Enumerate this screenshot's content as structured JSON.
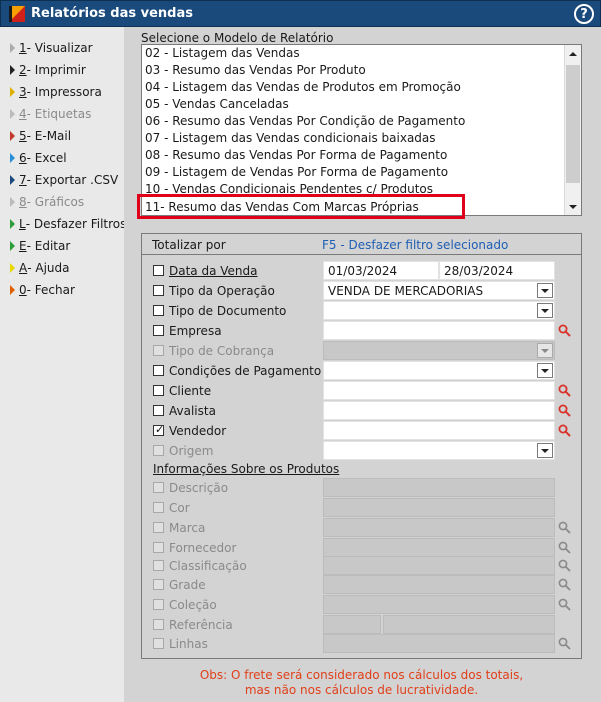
{
  "window": {
    "title": "Relatórios das vendas",
    "help_label": "?"
  },
  "sidebar": {
    "items": [
      {
        "key": "1",
        "text": " - Visualizar"
      },
      {
        "key": "2",
        "text": " - Imprimir"
      },
      {
        "key": "3",
        "text": " - Impressora"
      },
      {
        "key": "4",
        "text": " - Etiquetas"
      },
      {
        "key": "5",
        "text": " - E-Mail"
      },
      {
        "key": "6",
        "text": " - Excel"
      },
      {
        "key": "7",
        "text": " - Exportar .CSV"
      },
      {
        "key": "8",
        "text": " - Gráficos"
      },
      {
        "key": "L",
        "text": " - Desfazer Filtros"
      },
      {
        "key": "E",
        "text": " - Editar"
      },
      {
        "key": "A",
        "text": " - Ajuda"
      },
      {
        "key": "0",
        "text": " - Fechar"
      }
    ]
  },
  "report_select": {
    "label": "Selecione o Modelo de Relatório",
    "items": [
      "02 - Listagem das Vendas",
      "03 - Resumo das Vendas Por Produto",
      "04 - Listagem das Vendas de Produtos em Promoção",
      "05 - Vendas Canceladas",
      "06 - Resumo das Vendas Por Condição de Pagamento",
      "07 - Listagem das Vendas condicionais baixadas",
      "08 - Resumo das Vendas Por Forma de Pagamento",
      "09 - Listagem de Vendas Por Forma de Pagamento",
      "10 - Vendas Condicionais Pendentes c/ Produtos",
      "11- Resumo das Vendas Com Marcas Próprias"
    ]
  },
  "filters": {
    "totalizar": "Totalizar por",
    "f5": "F5 - Desfazer filtro selecionado",
    "data_venda": {
      "label": "Data da Venda",
      "from": "01/03/2024",
      "to": "28/03/2024"
    },
    "tipo_operacao": {
      "label": "Tipo da Operação",
      "value": "VENDA DE MERCADORIAS"
    },
    "tipo_documento": {
      "label": "Tipo de Documento"
    },
    "empresa": {
      "label": "Empresa"
    },
    "tipo_cobranca": {
      "label": "Tipo de Cobrança"
    },
    "condicoes_pagamento": {
      "label": "Condições de Pagamento"
    },
    "cliente": {
      "label": "Cliente"
    },
    "avalista": {
      "label": "Avalista"
    },
    "vendedor": {
      "label": "Vendedor"
    },
    "origem": {
      "label": "Origem"
    },
    "produtos_title": "Informações Sobre os Produtos",
    "descricao": {
      "label": "Descrição"
    },
    "cor": {
      "label": "Cor"
    },
    "marca": {
      "label": "Marca"
    },
    "fornecedor": {
      "label": "Fornecedor"
    },
    "classificacao": {
      "label": "Classificação"
    },
    "grade": {
      "label": "Grade"
    },
    "colecao": {
      "label": "Coleção"
    },
    "referencia": {
      "label": "Referência"
    },
    "linhas": {
      "label": "Linhas"
    }
  },
  "obs": {
    "line1": "Obs: O frete será considerado nos cálculos dos totais,",
    "line2": "mas não nos cálculos de lucratividade."
  },
  "colors": {
    "titlebar": "#1a4a7c",
    "highlight": "#e0001a",
    "link": "#1e5fb5",
    "obs": "#e0401a"
  }
}
